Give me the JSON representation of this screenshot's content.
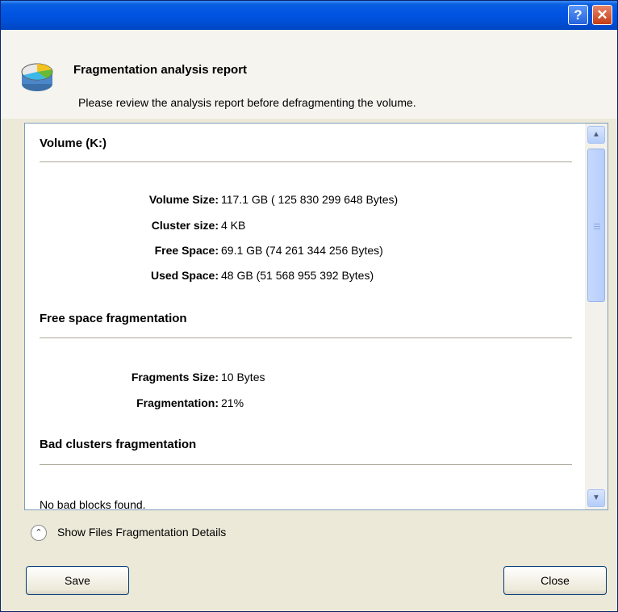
{
  "titlebar": {
    "help_label": "?",
    "close_label": "✕"
  },
  "header": {
    "title": "Fragmentation analysis report",
    "subtitle": "Please review the analysis report before defragmenting the volume.",
    "icon": "disk-chart-icon"
  },
  "report": {
    "volume": {
      "title": "Volume (K:)",
      "rows": [
        {
          "label": "Volume Size:",
          "value": "117.1 GB ( 125 830 299 648 Bytes)"
        },
        {
          "label": "Cluster size:",
          "value": "4 KB"
        },
        {
          "label": "Free Space:",
          "value": "69.1 GB (74 261 344 256 Bytes)"
        },
        {
          "label": "Used Space:",
          "value": "48 GB (51 568 955 392 Bytes)"
        }
      ]
    },
    "free_space": {
      "title": "Free space fragmentation",
      "rows": [
        {
          "label": "Fragments Size:",
          "value": "10 Bytes"
        },
        {
          "label": "Fragmentation:",
          "value": "21%"
        }
      ]
    },
    "bad_clusters": {
      "title": "Bad clusters fragmentation",
      "message": "No bad blocks found."
    }
  },
  "scrollbar": {
    "up_icon": "scroll-up-icon",
    "down_icon": "scroll-down-icon"
  },
  "details_toggle": {
    "label": "Show Files Fragmentation Details",
    "icon": "double-chevron-up-icon"
  },
  "buttons": {
    "save": "Save",
    "close": "Close"
  },
  "colors": {
    "titlebar": "#0054e3",
    "dialog_bg": "#ece9d8",
    "border": "#7f9db9"
  }
}
